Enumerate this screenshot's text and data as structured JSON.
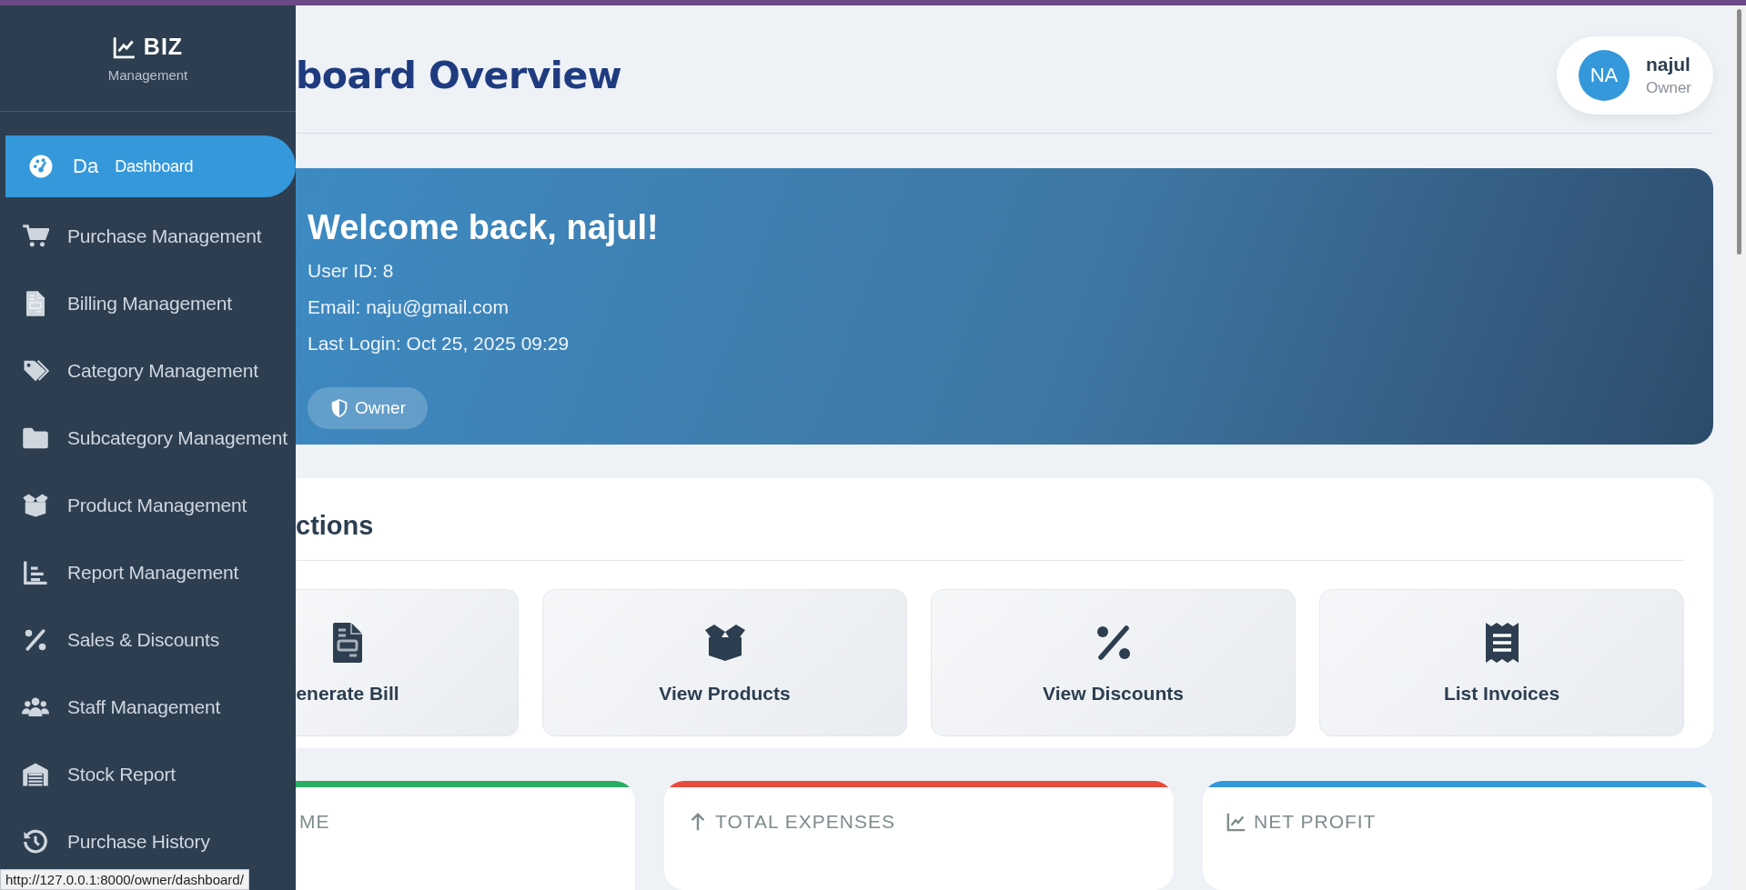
{
  "sidebar": {
    "logo": "BIZ",
    "subtitle": "Management",
    "items": [
      {
        "short": "Da",
        "label": "Dashboard",
        "selected": true
      },
      {
        "label": "Purchase Management",
        "selected": false
      },
      {
        "label": "Billing Management",
        "selected": false
      },
      {
        "label": "Category Management",
        "selected": false
      },
      {
        "label": "Subcategory Management",
        "selected": false
      },
      {
        "label": "Product Management",
        "selected": false
      },
      {
        "label": "Report Management",
        "selected": false
      },
      {
        "label": "Sales & Discounts",
        "selected": false
      },
      {
        "label": "Staff Management",
        "selected": false
      },
      {
        "label": "Stock Report",
        "selected": false
      },
      {
        "label": "Purchase History",
        "selected": false
      }
    ]
  },
  "header": {
    "title": "board Overview",
    "user": {
      "initials": "NA",
      "name": "najul",
      "role": "Owner"
    }
  },
  "welcome": {
    "heading": "Welcome back, najul!",
    "lines": [
      "User ID: 8",
      "Email: naju@gmail.com",
      "Last Login: Oct 25, 2025 09:29"
    ],
    "badge": "Owner"
  },
  "quick_actions": {
    "heading": "ctions",
    "actions": [
      {
        "label": "enerate Bill"
      },
      {
        "label": "View Products"
      },
      {
        "label": "View Discounts"
      },
      {
        "label": "List Invoices"
      }
    ]
  },
  "stats": [
    {
      "label": "ME",
      "color": "#27ae60"
    },
    {
      "label": "TOTAL EXPENSES",
      "color": "#e74c3c"
    },
    {
      "label": "NET PROFIT",
      "color": "#3498db"
    }
  ],
  "status_bar": {
    "url": "http://127.0.0.1:8000/owner/dashboard/"
  }
}
